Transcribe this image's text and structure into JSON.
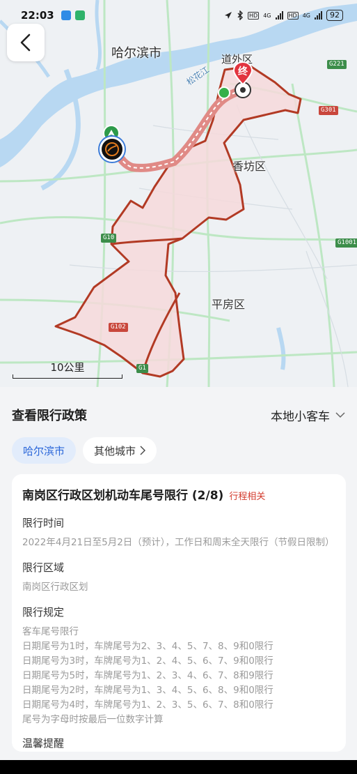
{
  "status_bar": {
    "time": "22:03",
    "network": "4G",
    "hd": "HD",
    "battery": "92"
  },
  "map": {
    "labels": {
      "harbin": "哈尔滨市",
      "daowai": "道外区",
      "songhua": "松花江",
      "xiangfang": "香坊区",
      "pingfang": "平房区",
      "end_marker": "终"
    },
    "road_badges": {
      "g221": "G221",
      "g301": "G301",
      "g1001": "G1001",
      "g10": "G10",
      "g102": "G102",
      "g1": "G1"
    },
    "scale_label": "10公里",
    "colors": {
      "zone_fill": "#f6d9da",
      "zone_stroke": "#b23a24",
      "water": "#b8d8f2",
      "road": "#bde7c3",
      "route": "#e08a86"
    }
  },
  "panel": {
    "title": "查看限行政策",
    "vehicle_type": "本地小客车",
    "tabs": [
      {
        "label": "哈尔滨市",
        "active": true
      },
      {
        "label": "其他城市",
        "active": false
      }
    ],
    "card": {
      "title": "南岗区行政区划机动车尾号限行 (2/8)",
      "tag": "行程相关",
      "sections": [
        {
          "heading": "限行时间",
          "text": "2022年4月21日至5月2日（预计），工作日和周末全天限行（节假日限制）"
        },
        {
          "heading": "限行区域",
          "text": "南岗区行政区划"
        }
      ],
      "rules_heading": "限行规定",
      "rules": [
        "客车尾号限行",
        "日期尾号为1时，车牌尾号为2、3、4、5、7、8、9和0限行",
        "日期尾号为3时，车牌尾号为1、2、4、5、6、7、9和0限行",
        "日期尾号为5时，车牌尾号为1、2、3、4、6、7、8和9限行",
        "日期尾号为2时，车牌尾号为1、3、4、5、6、8、9和0限行",
        "日期尾号为4时，车牌尾号为1、2、3、5、6、7、8和0限行",
        "尾号为字母时按最后一位数字计算"
      ],
      "tips_heading": "温馨提醒"
    }
  }
}
